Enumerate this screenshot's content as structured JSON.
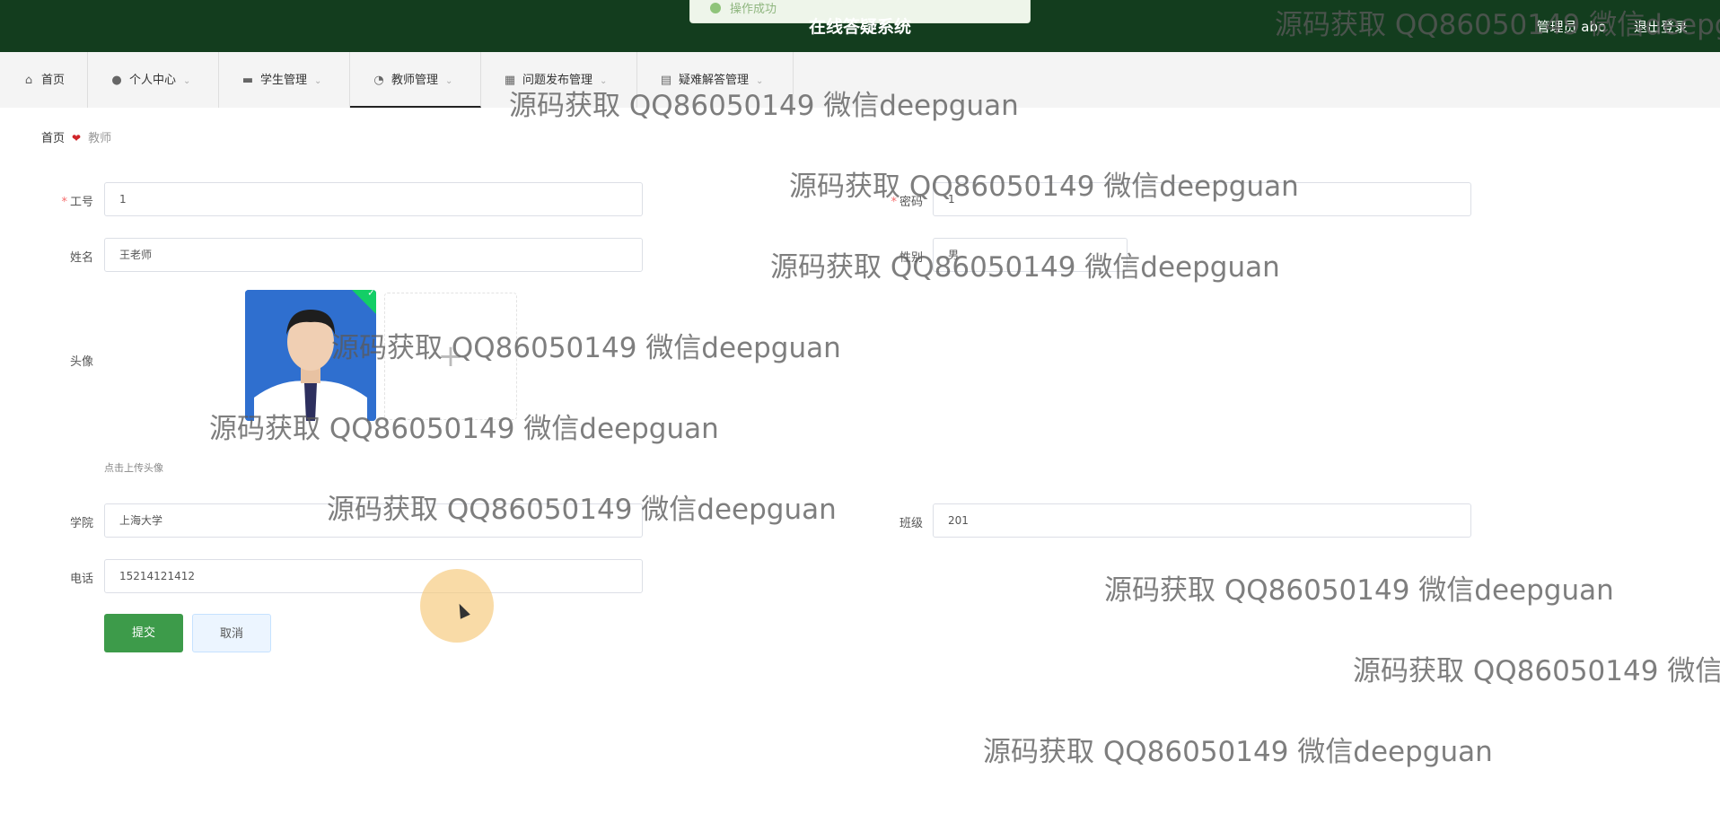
{
  "header": {
    "title": "在线答疑系统",
    "user": "管理员 abo",
    "logout": "退出登录",
    "toast": "操作成功"
  },
  "nav": {
    "items": [
      {
        "label": "首页",
        "icon": "home-icon"
      },
      {
        "label": "个人中心",
        "icon": "user-icon"
      },
      {
        "label": "学生管理",
        "icon": "briefcase-icon"
      },
      {
        "label": "教师管理",
        "icon": "gauge-icon"
      },
      {
        "label": "问题发布管理",
        "icon": "grid-icon"
      },
      {
        "label": "疑难解答管理",
        "icon": "clipboard-icon"
      }
    ]
  },
  "breadcrumb": {
    "home": "首页",
    "current": "教师"
  },
  "form": {
    "id_label": "工号",
    "id_value": "1",
    "password_label": "密码",
    "password_value": "1",
    "name_label": "姓名",
    "name_value": "王老师",
    "gender_label": "性别",
    "gender_value": "男",
    "avatar_label": "头像",
    "upload_tip": "点击上传头像",
    "college_label": "学院",
    "college_value": "上海大学",
    "class_label": "班级",
    "class_value": "201",
    "phone_label": "电话",
    "phone_value": "15214121412",
    "submit": "提交",
    "cancel": "取消"
  },
  "watermark": "源码获取 QQ86050149 微信deepguan",
  "colors": {
    "header_bg": "#133d1e",
    "submit_bg": "#3d9b4a",
    "required": "#f56c6c"
  }
}
